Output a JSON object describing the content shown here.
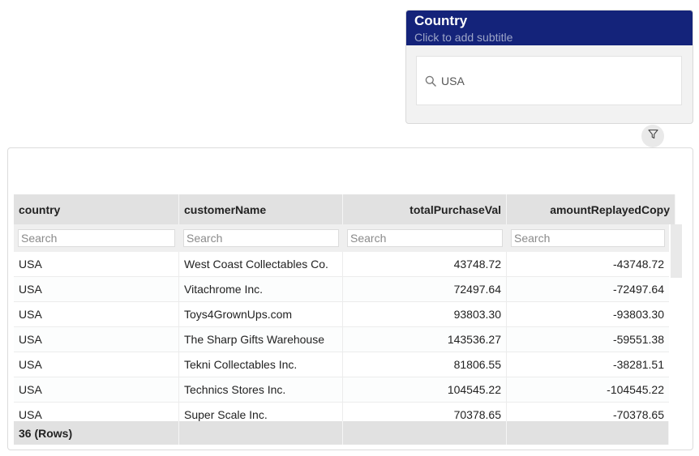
{
  "filter": {
    "title": "Country",
    "subtitle": "Click to add subtitle",
    "search_value": "USA",
    "search_icon": "search-icon"
  },
  "filter_toggle": {
    "icon": "filter-icon"
  },
  "table": {
    "columns": [
      "country",
      "customerName",
      "totalPurchaseVal",
      "amountReplayedCopy"
    ],
    "search_placeholder": "Search",
    "rows": [
      [
        "USA",
        "West Coast Collectables Co.",
        "43748.72",
        "-43748.72"
      ],
      [
        "USA",
        "Vitachrome Inc.",
        "72497.64",
        "-72497.64"
      ],
      [
        "USA",
        "Toys4GrownUps.com",
        "93803.30",
        "-93803.30"
      ],
      [
        "USA",
        "The Sharp Gifts Warehouse",
        "143536.27",
        "-59551.38"
      ],
      [
        "USA",
        "Tekni Collectables Inc.",
        "81806.55",
        "-38281.51"
      ],
      [
        "USA",
        "Technics Stores Inc.",
        "104545.22",
        "-104545.22"
      ],
      [
        "USA",
        "Super Scale Inc.",
        "70378.65",
        "-70378.65"
      ]
    ],
    "footer": {
      "row_count": "36 (Rows)"
    }
  }
}
